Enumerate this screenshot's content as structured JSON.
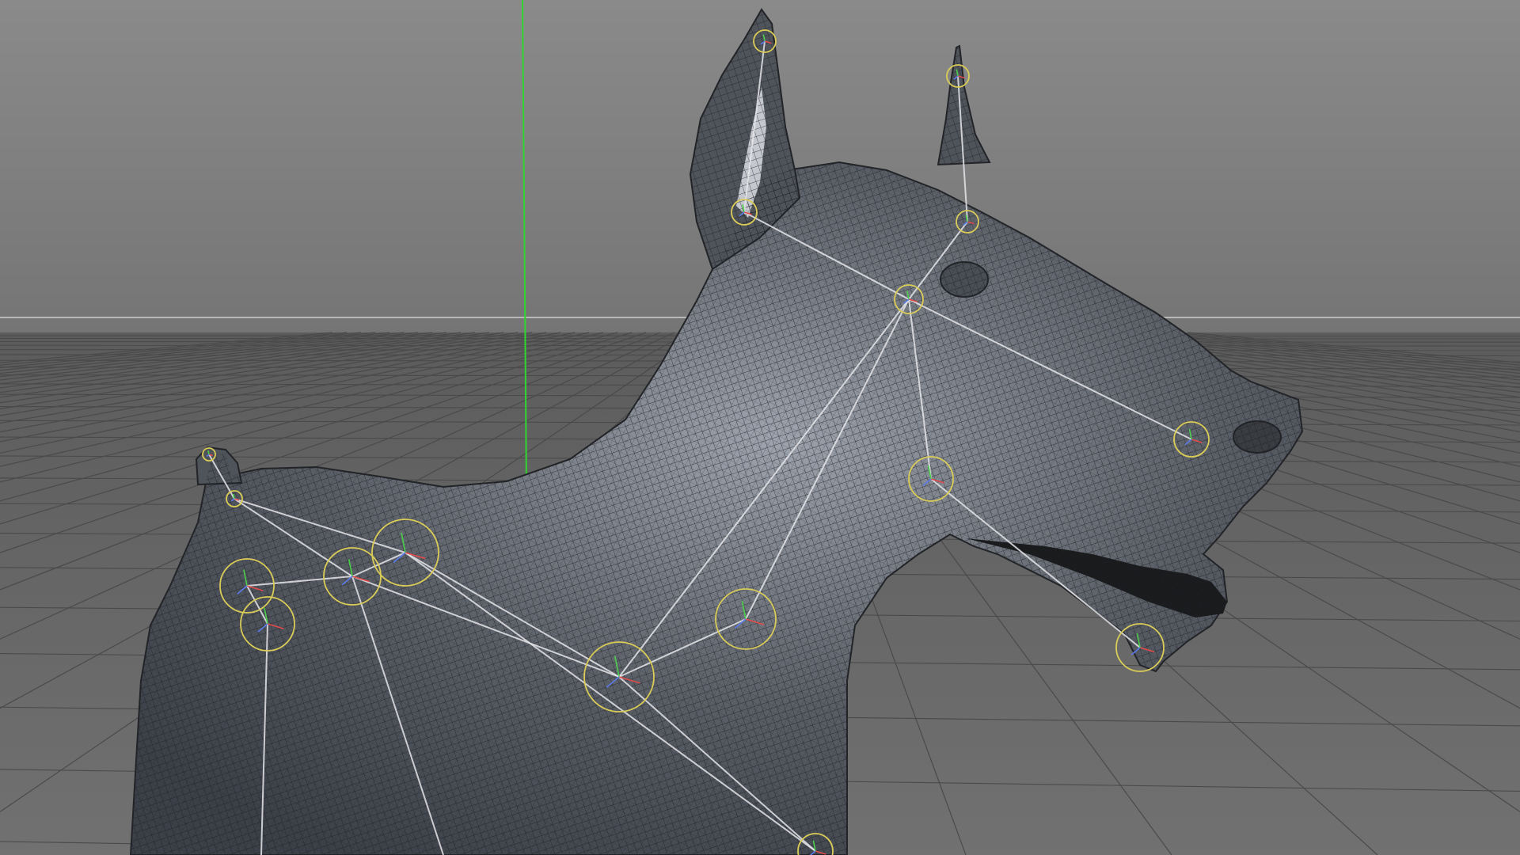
{
  "viewport": {
    "background_top": "#8a8a8a",
    "background_mid": "#757575",
    "horizon_line": "#b8b8b8",
    "floor_top": "#5c5c5c",
    "floor_bottom": "#717171",
    "grid_color": "#4a4a4a",
    "y_axis_color": "#2fd62f"
  },
  "model": {
    "mesh_fill": "#5a5e66",
    "mesh_dark": "#3c4048",
    "mesh_highlight": "#9ea4ae",
    "wireframe": "#1d1f24",
    "ear_inner_highlight": "#d8dce2",
    "mouth_dark": "#1a1b1d"
  },
  "rig": {
    "bone_color": "#e6e6ea",
    "joint_ring_color": "#d9cc57",
    "axis_x": "#e24a4a",
    "axis_y": "#4ad04a",
    "axis_z": "#5a7ae8"
  }
}
